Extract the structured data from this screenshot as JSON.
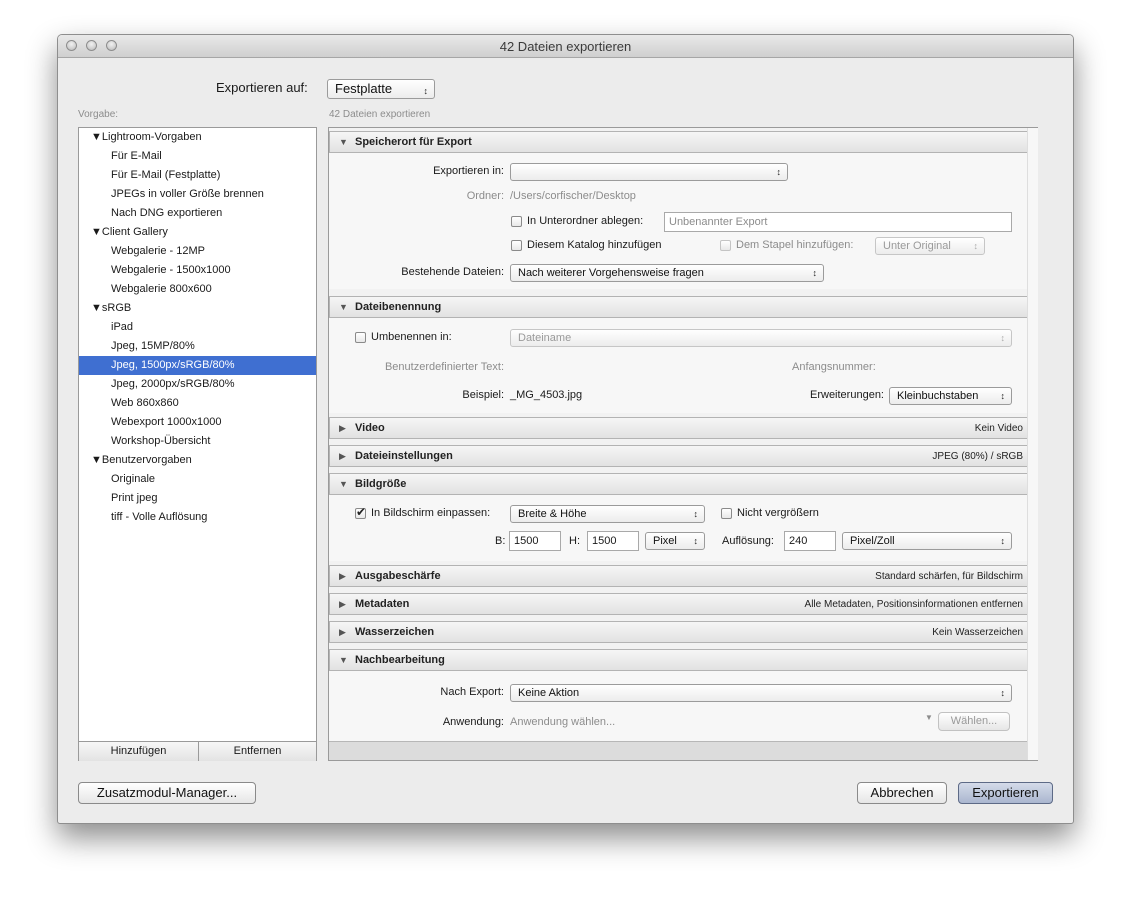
{
  "window": {
    "title": "42 Dateien exportieren"
  },
  "export_to": {
    "label": "Exportieren auf:",
    "value": "Festplatte"
  },
  "presets": {
    "label": "Vorgabe:",
    "items": [
      {
        "label": "▼Lightroom-Vorgaben",
        "folder": true
      },
      {
        "label": "Für E-Mail"
      },
      {
        "label": "Für E-Mail (Festplatte)"
      },
      {
        "label": "JPEGs in voller Größe brennen"
      },
      {
        "label": "Nach DNG exportieren"
      },
      {
        "label": "▼Client Gallery",
        "folder": true
      },
      {
        "label": "Webgalerie - 12MP"
      },
      {
        "label": "Webgalerie - 1500x1000"
      },
      {
        "label": "Webgalerie 800x600"
      },
      {
        "label": "▼sRGB",
        "folder": true
      },
      {
        "label": "iPad"
      },
      {
        "label": "Jpeg, 15MP/80%"
      },
      {
        "label": "Jpeg, 1500px/sRGB/80%",
        "selected": true
      },
      {
        "label": "Jpeg, 2000px/sRGB/80%"
      },
      {
        "label": "Web 860x860"
      },
      {
        "label": "Webexport 1000x1000"
      },
      {
        "label": "Workshop-Übersicht"
      },
      {
        "label": "▼Benutzervorgaben",
        "folder": true
      },
      {
        "label": "Originale"
      },
      {
        "label": "Print jpeg"
      },
      {
        "label": "tiff - Volle Auflösung"
      }
    ],
    "add_label": "Hinzufügen",
    "remove_label": "Entfernen"
  },
  "panel_label": "42 Dateien exportieren",
  "sections": {
    "location": {
      "title": "Speicherort für Export",
      "export_in_label": "Exportieren in:",
      "export_in_value": "",
      "folder_label": "Ordner:",
      "folder_path": "/Users/corfischer/Desktop",
      "subfolder_label": "In Unterordner ablegen:",
      "subfolder_placeholder": "Unbenannter Export",
      "catalog_label": "Diesem Katalog hinzufügen",
      "stack_label": "Dem Stapel hinzufügen:",
      "stack_value": "Unter Original",
      "existing_label": "Bestehende Dateien:",
      "existing_value": "Nach weiterer Vorgehensweise fragen"
    },
    "naming": {
      "title": "Dateibenennung",
      "rename_label": "Umbenennen in:",
      "rename_value": "Dateiname",
      "custom_text_label": "Benutzerdefinierter Text:",
      "start_number_label": "Anfangsnummer:",
      "example_label": "Beispiel:",
      "example_value": "_MG_4503.jpg",
      "extensions_label": "Erweiterungen:",
      "extensions_value": "Kleinbuchstaben"
    },
    "video": {
      "title": "Video",
      "summary": "Kein Video"
    },
    "file_settings": {
      "title": "Dateieinstellungen",
      "summary": "JPEG (80%) / sRGB"
    },
    "size": {
      "title": "Bildgröße",
      "fit_label": "In Bildschirm einpassen:",
      "fit_checked": true,
      "fit_value": "Breite & Höhe",
      "no_enlarge_label": "Nicht vergrößern",
      "w_label": "B:",
      "w_value": "1500",
      "h_label": "H:",
      "h_value": "1500",
      "unit_value": "Pixel",
      "resolution_label": "Auflösung:",
      "resolution_value": "240",
      "resolution_unit": "Pixel/Zoll"
    },
    "sharpening": {
      "title": "Ausgabeschärfe",
      "summary": "Standard schärfen, für Bildschirm"
    },
    "metadata": {
      "title": "Metadaten",
      "summary": "Alle Metadaten, Positionsinformationen entfernen"
    },
    "watermark": {
      "title": "Wasserzeichen",
      "summary": "Kein Wasserzeichen"
    },
    "post": {
      "title": "Nachbearbeitung",
      "after_label": "Nach Export:",
      "after_value": "Keine Aktion",
      "app_label": "Anwendung:",
      "app_placeholder": "Anwendung wählen...",
      "choose_label": "Wählen..."
    }
  },
  "footer": {
    "plugin_manager_label": "Zusatzmodul-Manager...",
    "cancel_label": "Abbrechen",
    "export_label": "Exportieren"
  },
  "icons": {
    "expanded": "▼",
    "collapsed": "▶",
    "updown": "↕"
  },
  "colors": {
    "selection": "#3f6fd1",
    "default_button": "#b9c3d8"
  }
}
